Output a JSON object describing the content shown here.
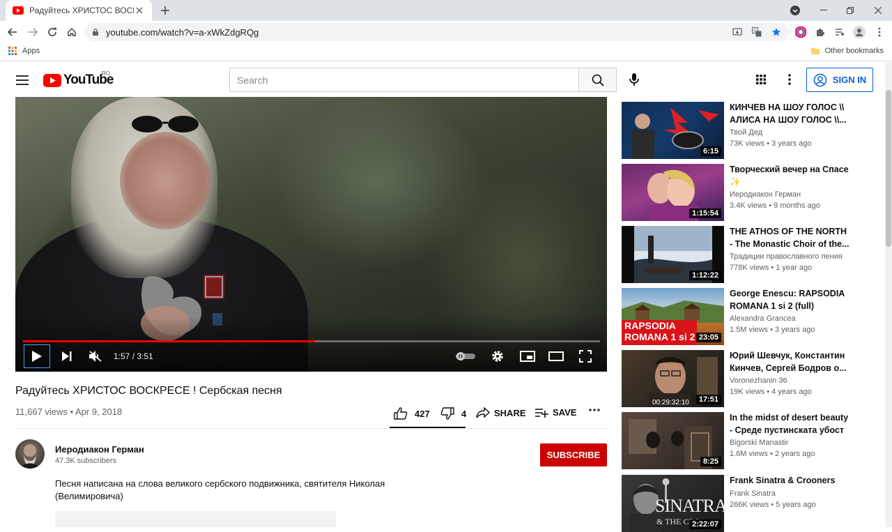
{
  "browser": {
    "tab_title": "Радуйтесь ХРИСТОС ВОСКРЕСЕ !",
    "url": "youtube.com/watch?v=a-xWkZdgRQg",
    "bookmarks": {
      "apps_label": "Apps",
      "other_label": "Other bookmarks"
    }
  },
  "masthead": {
    "logo_text": "YouTube",
    "region": "RO",
    "search_placeholder": "Search",
    "signin_label": "SIGN IN"
  },
  "player": {
    "current_time": "1:57",
    "duration": "3:51",
    "timecode": "1:57 / 3:51",
    "progress_fraction": 0.506
  },
  "video": {
    "title": "Радуйтесь ХРИСТОС ВОСКРЕСЕ ! Сербская песня",
    "meta": "11,667 views • Apr 9, 2018",
    "likes": "427",
    "dislikes": "4",
    "share_label": "SHARE",
    "save_label": "SAVE"
  },
  "channel": {
    "name": "Иеродиакон Герман",
    "subscribers": "47.3K subscribers",
    "subscribe_label": "SUBSCRIBE"
  },
  "description": {
    "text": "Песня написана на слова великого сербского подвижника, святителя Николая (Велимировича)"
  },
  "recommendations": [
    {
      "title": "КИНЧЕВ НА ШОУ ГОЛОС \\\\ АЛИСА НА ШОУ ГОЛОС \\\\...",
      "channel": "Твой Дед",
      "views": "73K views • 3 years ago",
      "duration": "6:15"
    },
    {
      "title": "Творческий вечер на Спасе ✨",
      "channel": "Иеродиакон Герман",
      "views": "3.4K views • 9 months ago",
      "duration": "1:15:54"
    },
    {
      "title": "THE ATHOS OF THE NORTH - The Monastic Choir of the...",
      "channel": "Традиции православного пения",
      "views": "778K views • 1 year ago",
      "duration": "1:12:22"
    },
    {
      "title": "George Enescu: RAPSODIA ROMANA 1 si 2 (full)",
      "channel": "Alexandra Grancea",
      "views": "1.5M views • 3 years ago",
      "duration": "23:05",
      "thumb_text_1": "RAPSODIA",
      "thumb_text_2": "ROMANA 1 si 2"
    },
    {
      "title": "Юрий Шевчук, Константин Кинчев, Сергей Бодров о...",
      "channel": "Voronezhanin 36",
      "views": "19K views • 4 years ago",
      "duration": "17:51",
      "thumb_text_1": "00:29:32:10"
    },
    {
      "title": "In the midst of desert beauty - Среде пустинската убост",
      "channel": "Bigorski Manastir",
      "views": "1.6M views • 2 years ago",
      "duration": "8:25"
    },
    {
      "title": "Frank Sinatra & Crooners",
      "channel": "Frank Sinatra",
      "views": "266K views • 5 years ago",
      "duration": "2:22:07",
      "thumb_text_1": "SINATRA",
      "thumb_text_2": "& THE CRO"
    }
  ],
  "colors": {
    "youtube_red": "#FF0000",
    "subscribe_bg": "#CC0000",
    "link_blue": "#065FD4"
  }
}
